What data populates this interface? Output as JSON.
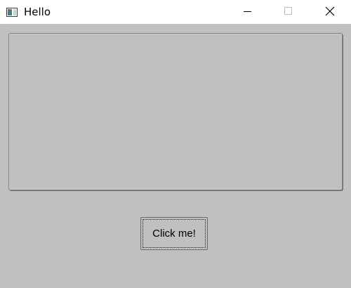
{
  "window": {
    "title": "Hello",
    "icons": {
      "app": "window-app-icon",
      "minimize": "minimize-icon",
      "maximize": "maximize-icon",
      "close": "close-icon"
    }
  },
  "main": {
    "button_label": "Click me!"
  },
  "colors": {
    "background": "#c0c0c0",
    "titlebar": "#ffffff"
  }
}
